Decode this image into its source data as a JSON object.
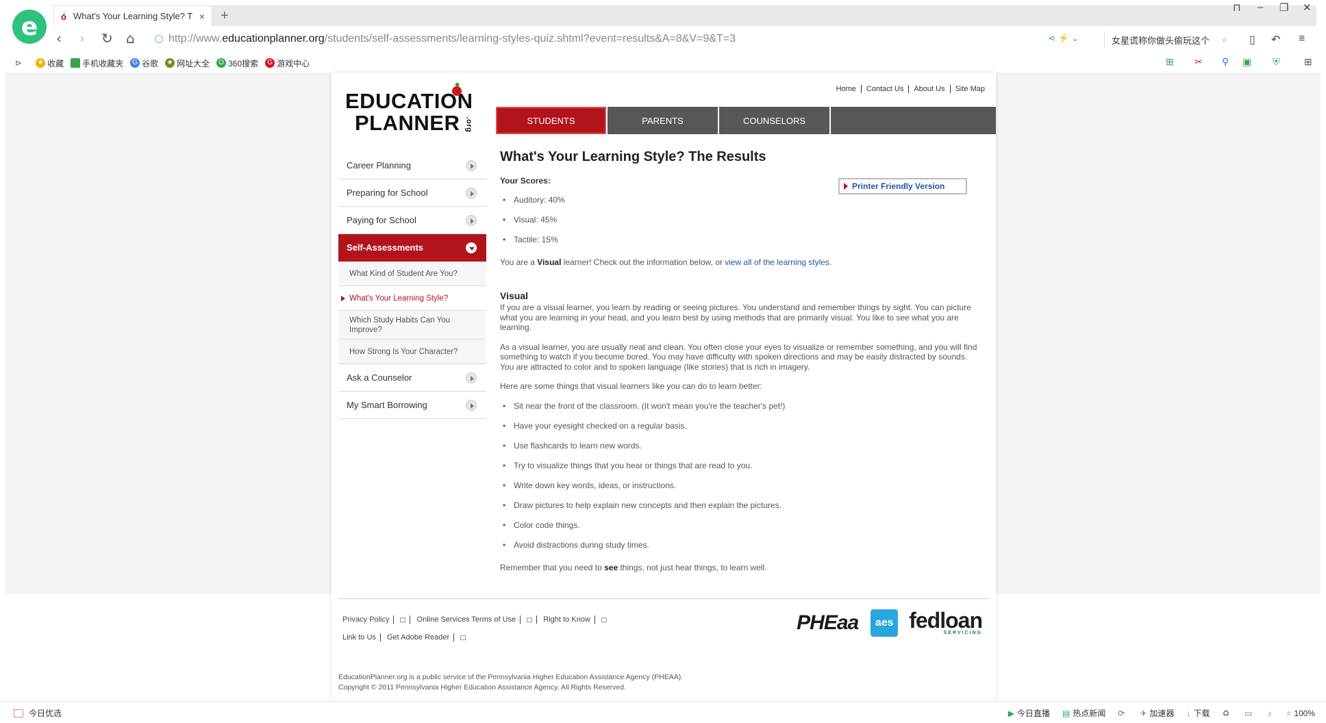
{
  "browser": {
    "tab_title": "What's Your Learning Style? T",
    "tab_close": "×",
    "new_tab": "+",
    "url_prefix": "http://www.",
    "url_domain": "educationplanner.org",
    "url_path": "/students/self-assessments/learning-styles-quiz.shtml?event=results&A=8&V=9&T=3",
    "search_text": "女星谎称你做头偷玩这个",
    "bookmarks": [
      "收藏",
      "手机收藏夹",
      "谷歌",
      "网址大全",
      "360搜索",
      "游戏中心"
    ]
  },
  "site": {
    "logo_line1": "EDUCATION",
    "logo_line2": "PLANNER",
    "logo_org": ".org",
    "utility_links": [
      "Home",
      "Contact Us",
      "About Us",
      "Site Map"
    ],
    "nav_tabs": [
      "STUDENTS",
      "PARENTS",
      "COUNSELORS"
    ],
    "sidebar": {
      "career": "Career Planning",
      "preparing": "Preparing for School",
      "paying": "Paying for School",
      "self": "Self-Assessments",
      "sub": [
        "What Kind of Student Are You?",
        "What's Your Learning Style?",
        "Which Study Habits Can You Improve?",
        "How Strong Is Your Character?"
      ],
      "counselor": "Ask a Counselor",
      "borrowing": "My Smart Borrowing"
    }
  },
  "content": {
    "title": "What's Your Learning Style? The Results",
    "scores_label": "Your Scores:",
    "printer": "Printer Friendly Version",
    "scores": [
      "Auditory: 40%",
      "Visual: 45%",
      "Tactile: 15%"
    ],
    "verdict_pre": "You are a ",
    "verdict_style": "Visual",
    "verdict_mid": " learner! Check out the information below, or ",
    "verdict_link": "view all of the learning styles",
    "verdict_end": ".",
    "section_title": "Visual",
    "para1": "If you are a visual learner, you learn by reading or seeing pictures. You understand and remember things by sight. You can picture what you are learning in your head, and you learn best by using methods that are primarily visual. You like to see what you are learning.",
    "para2": "As a visual learner, you are usually neat and clean. You often close your eyes to visualize or remember something, and you will find something to watch if you become bored. You may have difficulty with spoken directions and may be easily distracted by sounds. You are attracted to color and to spoken language (like stories) that is rich in imagery.",
    "para3": "Here are some things that visual learners like you can do to learn better:",
    "tips": [
      "Sit near the front of the classroom. (It won't mean you're the teacher's pet!)",
      "Have your eyesight checked on a regular basis.",
      "Use flashcards to learn new words.",
      "Try to visualize things that you hear or things that are read to you.",
      "Write down key words, ideas, or instructions.",
      "Draw pictures to help explain new concepts and then explain the pictures.",
      "Color code things.",
      "Avoid distractions during study times."
    ],
    "closing_pre": "Remember that you need to ",
    "closing_bold": "see",
    "closing_post": " things, not just hear things, to learn well."
  },
  "footer": {
    "links_row1": [
      "Privacy Policy",
      "Online Services Terms of Use",
      "Right to Know"
    ],
    "links_row2": [
      "Link to Us",
      "Get Adobe Reader"
    ],
    "pheaa": "PHEaa",
    "aes": "aes",
    "fedloan": "fedloan",
    "fedloan_sub": "SERVICING",
    "copy1": "EducationPlanner.org is a public service of the Pennsylvania Higher Education Assistance Agency (PHEAA).",
    "copy2": "Copyright © 2011 Pennsylvania Higher Education Assistance Agency. All Rights Reserved."
  },
  "status": {
    "left": "今日优选",
    "items": [
      "今日直播",
      "热点新闻",
      "加速器",
      "下载",
      "100%"
    ]
  },
  "colors": {
    "brand_red": "#b3141c",
    "nav_gray": "#575757",
    "link_blue": "#2355a0",
    "browser_green": "#2fc27e"
  }
}
